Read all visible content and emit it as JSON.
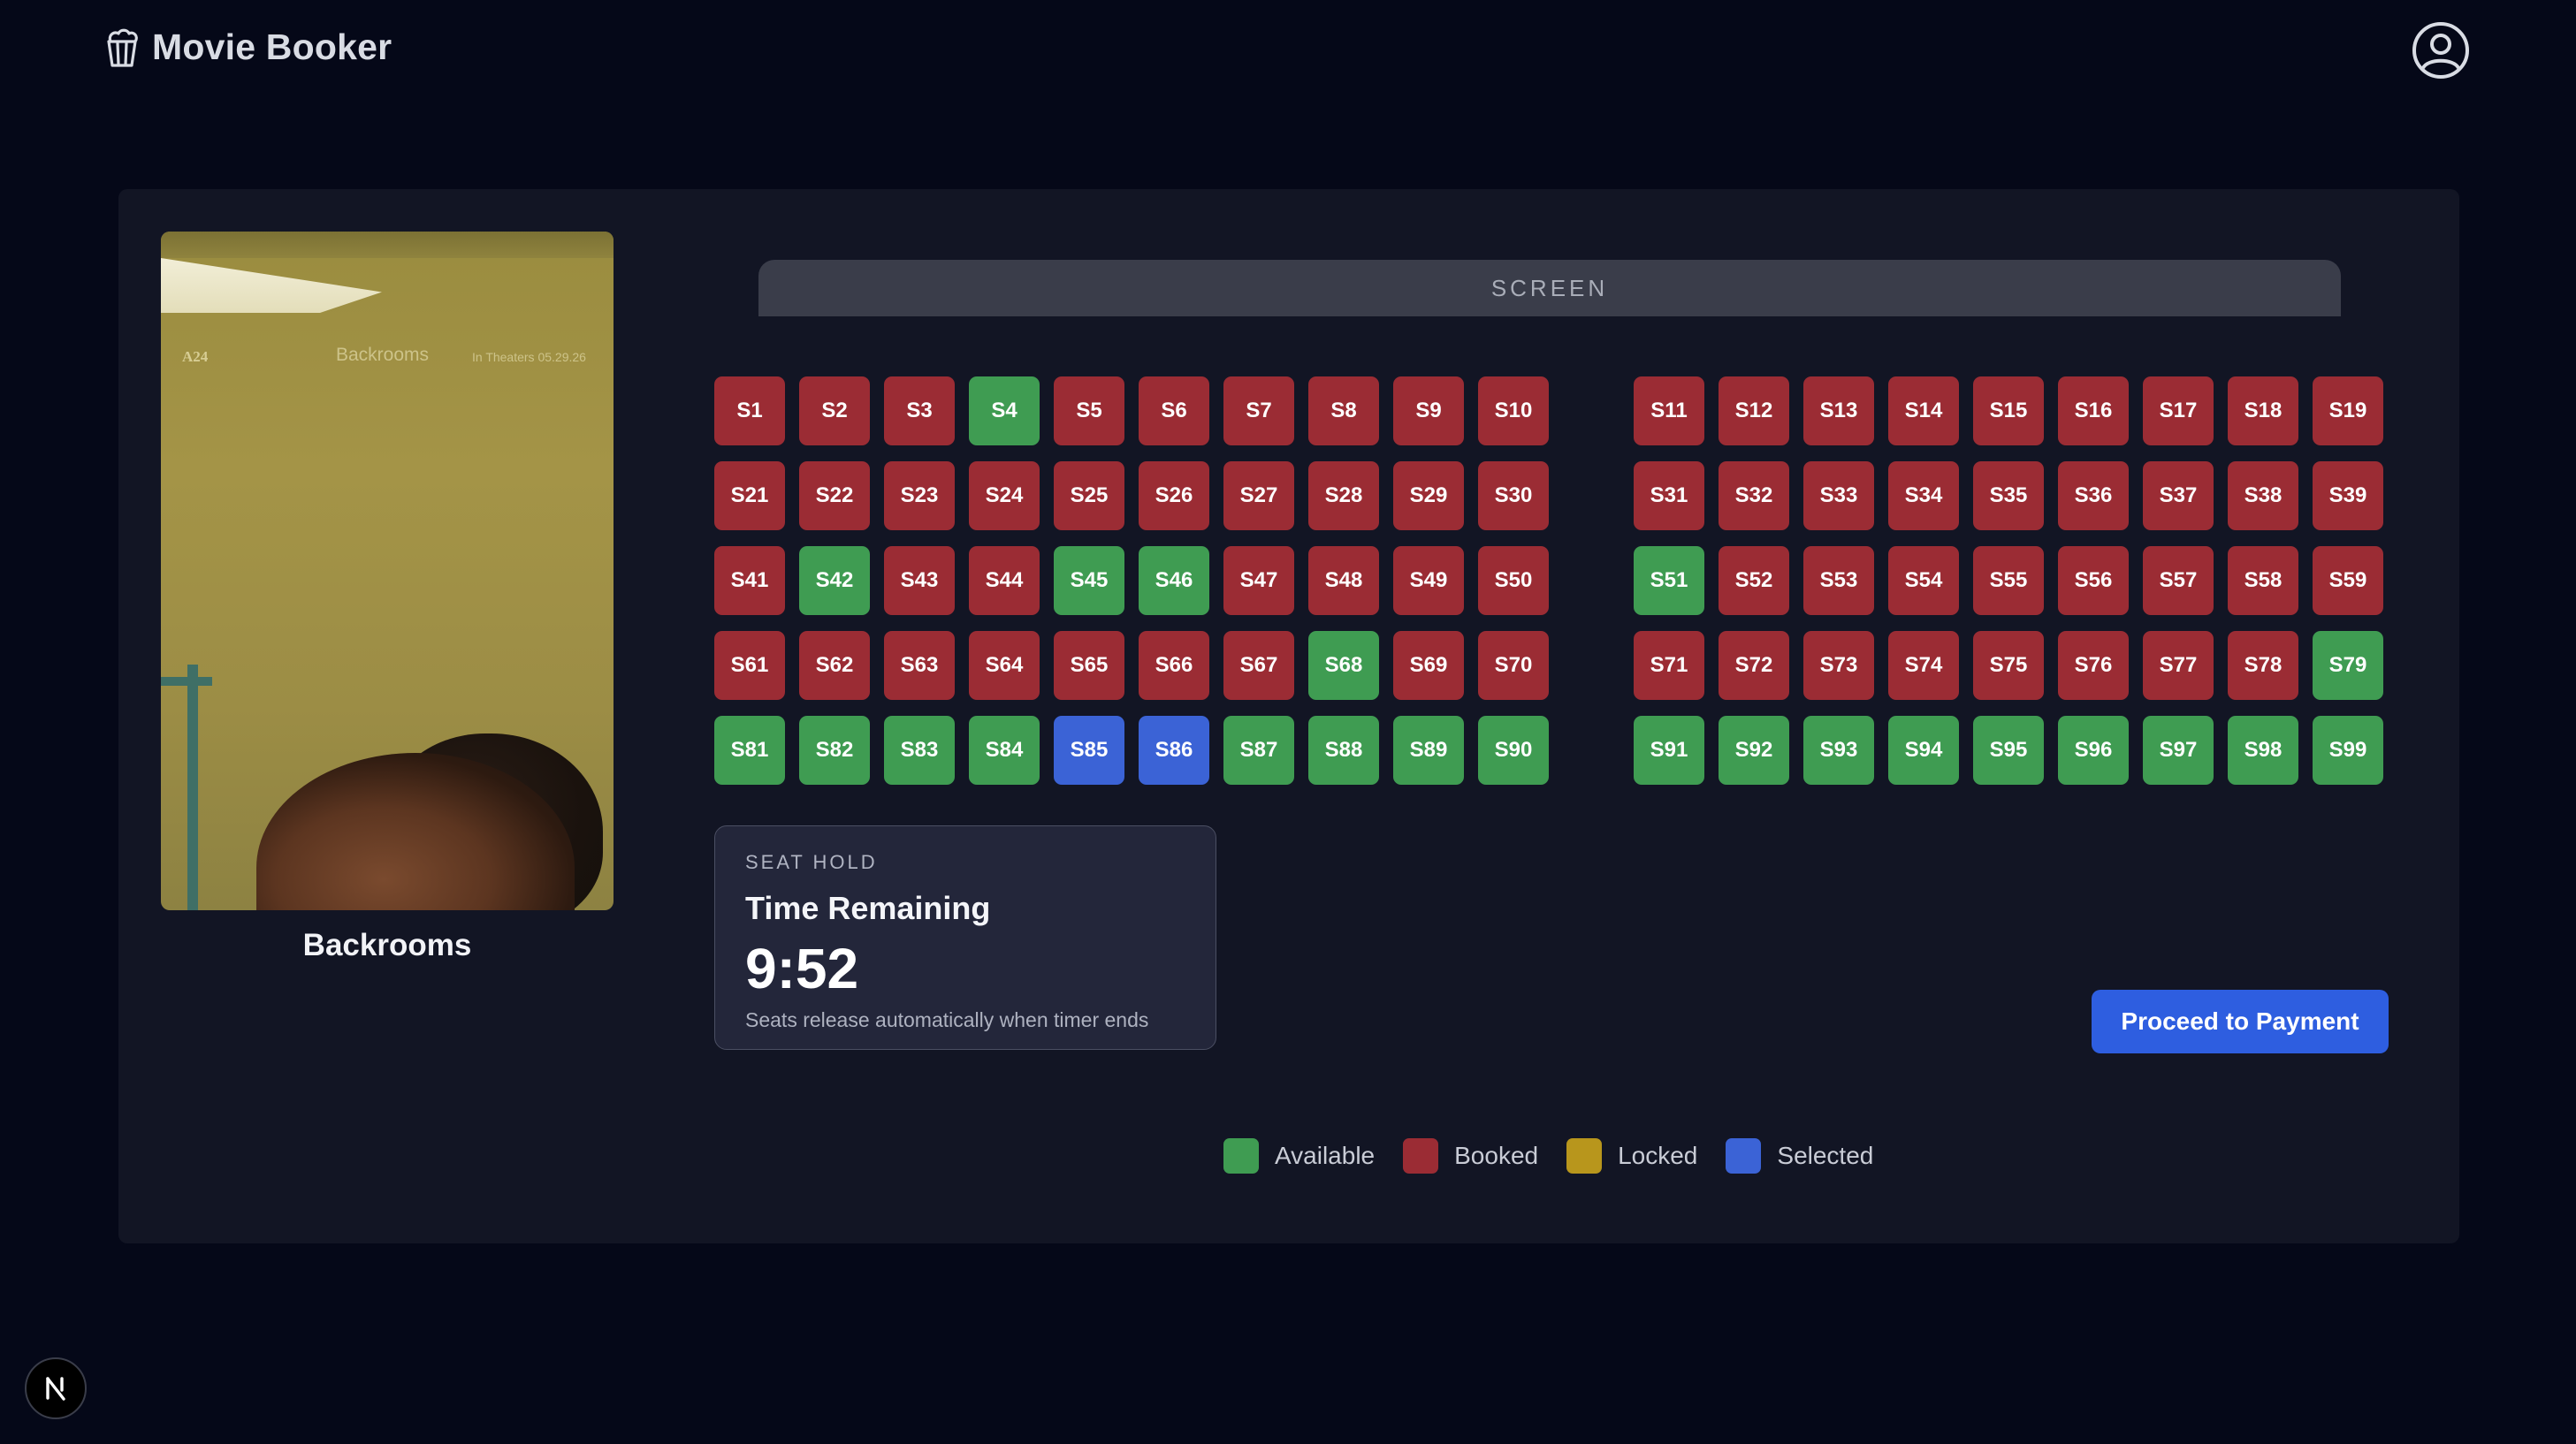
{
  "app": {
    "title": "Movie Booker",
    "logo_icon": "popcorn-icon",
    "account_icon": "user-circle-icon"
  },
  "movie": {
    "title": "Backrooms",
    "poster": {
      "studio": "A24",
      "title": "Backrooms",
      "release_text": "In Theaters 05.29.26"
    }
  },
  "screen_label": "SCREEN",
  "seat_statuses": {
    "1": "booked",
    "2": "booked",
    "3": "booked",
    "4": "available",
    "5": "booked",
    "6": "booked",
    "7": "booked",
    "8": "booked",
    "9": "booked",
    "10": "booked",
    "11": "booked",
    "12": "booked",
    "13": "booked",
    "14": "booked",
    "15": "booked",
    "16": "booked",
    "17": "booked",
    "18": "booked",
    "19": "booked",
    "21": "booked",
    "22": "booked",
    "23": "booked",
    "24": "booked",
    "25": "booked",
    "26": "booked",
    "27": "booked",
    "28": "booked",
    "29": "booked",
    "30": "booked",
    "31": "booked",
    "32": "booked",
    "33": "booked",
    "34": "booked",
    "35": "booked",
    "36": "booked",
    "37": "booked",
    "38": "booked",
    "39": "booked",
    "41": "booked",
    "42": "available",
    "43": "booked",
    "44": "booked",
    "45": "available",
    "46": "available",
    "47": "booked",
    "48": "booked",
    "49": "booked",
    "50": "booked",
    "51": "available",
    "52": "booked",
    "53": "booked",
    "54": "booked",
    "55": "booked",
    "56": "booked",
    "57": "booked",
    "58": "booked",
    "59": "booked",
    "61": "booked",
    "62": "booked",
    "63": "booked",
    "64": "booked",
    "65": "booked",
    "66": "booked",
    "67": "booked",
    "68": "available",
    "69": "booked",
    "70": "booked",
    "71": "booked",
    "72": "booked",
    "73": "booked",
    "74": "booked",
    "75": "booked",
    "76": "booked",
    "77": "booked",
    "78": "booked",
    "79": "available",
    "81": "available",
    "82": "available",
    "83": "available",
    "84": "available",
    "85": "selected",
    "86": "selected",
    "87": "available",
    "88": "available",
    "89": "available",
    "90": "available",
    "91": "available",
    "92": "available",
    "93": "available",
    "94": "available",
    "95": "available",
    "96": "available",
    "97": "available",
    "98": "available",
    "99": "available"
  },
  "seat_hold": {
    "eyebrow": "SEAT HOLD",
    "title": "Time Remaining",
    "time": "9:52",
    "note": "Seats release automatically when timer ends"
  },
  "proceed_button": "Proceed to Payment",
  "legend": [
    {
      "label": "Available",
      "color": "#3f9c52"
    },
    {
      "label": "Booked",
      "color": "#9b2c34"
    },
    {
      "label": "Locked",
      "color": "#b8961c"
    },
    {
      "label": "Selected",
      "color": "#3b63d6"
    }
  ],
  "status_colors": {
    "available": "#3f9c52",
    "booked": "#9b2c34",
    "locked": "#b8961c",
    "selected": "#3b63d6"
  },
  "dev_badge_icon": "nextjs-icon"
}
